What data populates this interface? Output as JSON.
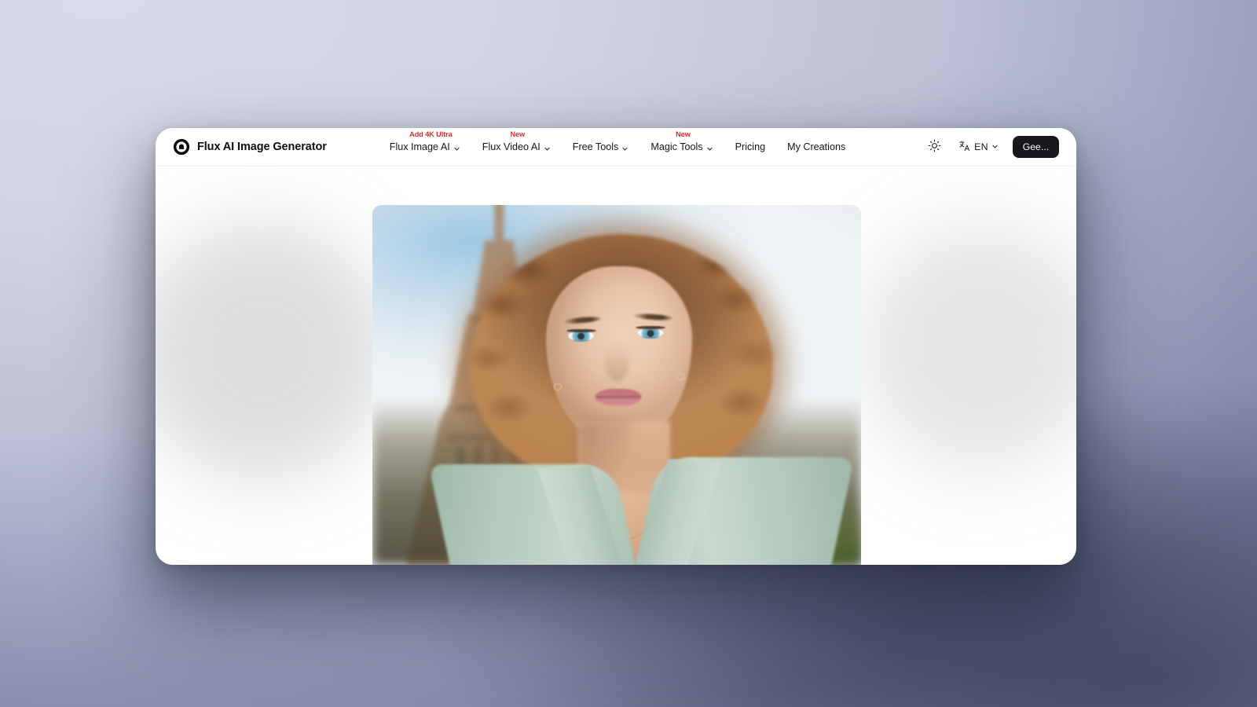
{
  "brand": {
    "logo_icon": "flux-circle-logo",
    "name": "Flux AI Image Generator"
  },
  "nav": {
    "items": [
      {
        "label": "Flux Image AI",
        "badge": "Add 4K Ultra",
        "has_dropdown": true,
        "icon": "chevron-down-icon"
      },
      {
        "label": "Flux Video AI",
        "badge": "New",
        "has_dropdown": true,
        "icon": "chevron-down-icon"
      },
      {
        "label": "Free Tools",
        "badge": "",
        "has_dropdown": true,
        "icon": "chevron-down-icon"
      },
      {
        "label": "Magic Tools",
        "badge": "New",
        "has_dropdown": true,
        "icon": "chevron-down-icon"
      },
      {
        "label": "Pricing",
        "badge": "",
        "has_dropdown": false,
        "icon": ""
      },
      {
        "label": "My Creations",
        "badge": "",
        "has_dropdown": false,
        "icon": ""
      }
    ],
    "badge_color": "#d32f2f"
  },
  "header_actions": {
    "theme_toggle": {
      "icon": "sun-icon",
      "label": ""
    },
    "language": {
      "icon": "translate-icon",
      "code": "EN",
      "chevron": "chevron-down-icon"
    },
    "cta": {
      "label": "Gee...",
      "background": "#17171c",
      "text_color": "#ffffff"
    }
  },
  "main": {
    "hero_image": {
      "alt": "Portrait of a young woman with curly auburn hair in a sage green jacket standing in front of the Eiffel Tower",
      "subject": "woman portrait",
      "landmark": "Eiffel Tower",
      "jacket_color": "#b4cbbd",
      "hair_color": "#92613a",
      "eye_color": "#63aecb",
      "sky_color": "#cfe1ee"
    },
    "background_color": "#ffffff"
  },
  "window": {
    "card_background": "#ffffff",
    "page_gradient_start": "#d7d8e5",
    "page_gradient_end": "#6b7190"
  }
}
